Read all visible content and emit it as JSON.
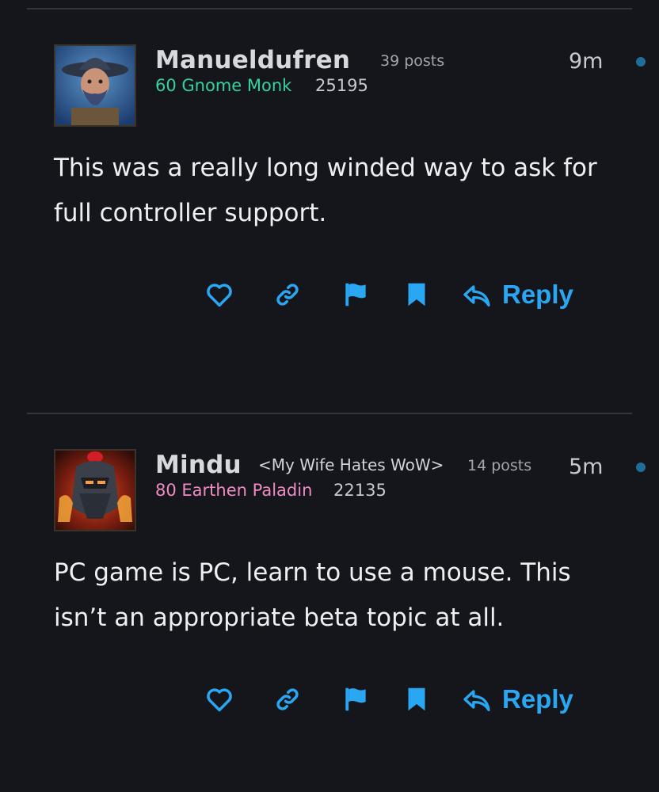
{
  "theme": {
    "accent": "#2aa7f3",
    "monk_color": "#33d39c",
    "paladin_color": "#f08bc3"
  },
  "posts": [
    {
      "author": "Manueldufren",
      "guild": "",
      "post_count": "39 posts",
      "time": "9m",
      "class_line": "60 Gnome Monk",
      "score": "25195",
      "avatar": "gnome-monk-avatar",
      "body": "This was a really long winded way to ask for full controller support.",
      "actions": {
        "like": "heart-icon",
        "link": "link-icon",
        "flag": "flag-icon",
        "bookmark": "bookmark-icon",
        "reply_label": "Reply"
      }
    },
    {
      "author": "Mindu",
      "guild": "<My Wife Hates WoW>",
      "post_count": "14 posts",
      "time": "5m",
      "class_line": "80 Earthen Paladin",
      "score": "22135",
      "avatar": "earthen-paladin-avatar",
      "body": "PC game is PC, learn to use a mouse. This isn’t an appropriate beta topic at all.",
      "actions": {
        "like": "heart-icon",
        "link": "link-icon",
        "flag": "flag-icon",
        "bookmark": "bookmark-icon",
        "reply_label": "Reply"
      }
    }
  ]
}
